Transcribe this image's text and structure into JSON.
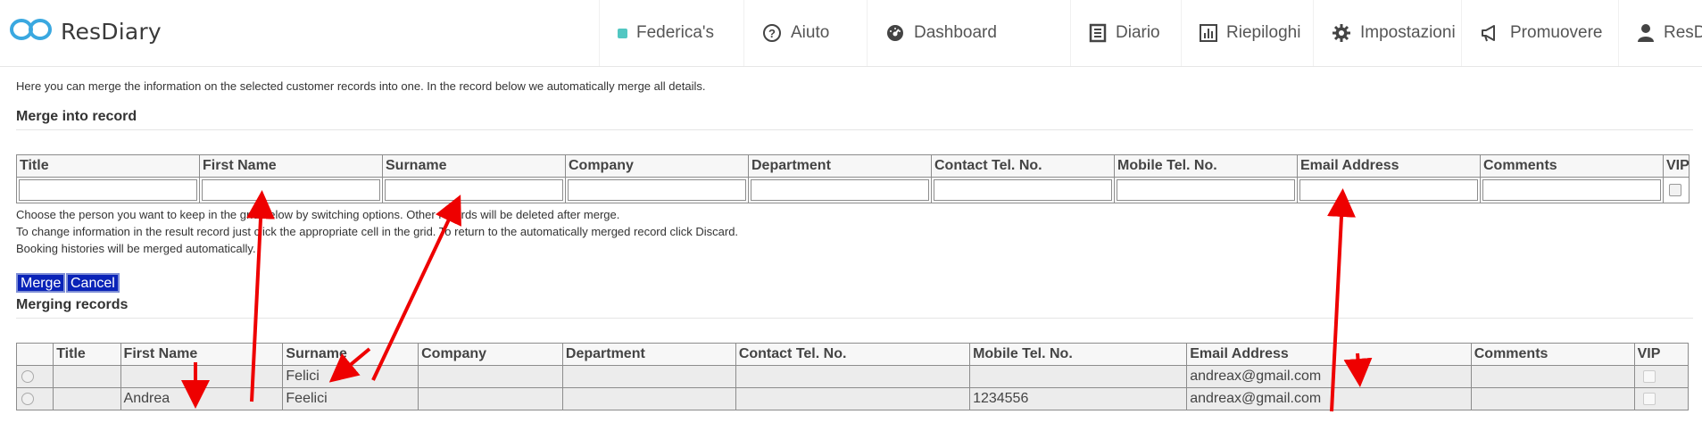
{
  "nav": {
    "brand": "ResDiary",
    "items": [
      {
        "icon": "restaurant-dot-icon",
        "label": "Federica's"
      },
      {
        "icon": "help-circle-icon",
        "label": "Aiuto"
      },
      {
        "icon": "dashboard-gauge-icon",
        "label": "Dashboard"
      },
      {
        "icon": "diary-book-icon",
        "label": "Diario"
      },
      {
        "icon": "bar-chart-icon",
        "label": "Riepiloghi"
      },
      {
        "icon": "gear-icon",
        "label": "Impostazioni"
      },
      {
        "icon": "megaphone-icon",
        "label": "Promuovere"
      },
      {
        "icon": "user-icon",
        "label": "ResDiary Tea..."
      }
    ]
  },
  "intro_text": "Here you can merge the information on the selected customer records into one. In the record below we automatically merge all details.",
  "merge_into": {
    "title": "Merge into record",
    "columns": [
      "Title",
      "First Name",
      "Surname",
      "Company",
      "Department",
      "Contact Tel. No.",
      "Mobile Tel. No.",
      "Email Address",
      "Comments",
      "VIP"
    ]
  },
  "help": {
    "line1": "Choose the person you want to keep in the grid below by switching options. Other records will be deleted after merge.",
    "line2": "To change information in the result record just click the appropriate cell in the grid. To return to the automatically merged record click Discard.",
    "line3": "Booking histories will be merged automatically."
  },
  "buttons": {
    "merge": "Merge",
    "cancel": "Cancel"
  },
  "merging": {
    "title": "Merging records",
    "columns": [
      "",
      "Title",
      "First Name",
      "Surname",
      "Company",
      "Department",
      "Contact Tel. No.",
      "Mobile Tel. No.",
      "Email Address",
      "Comments",
      "VIP"
    ],
    "rows": [
      {
        "title": "",
        "first_name": "",
        "surname": "Felici",
        "company": "",
        "department": "",
        "contact_tel": "",
        "mobile_tel": "",
        "email": "andreax@gmail.com",
        "comments": ""
      },
      {
        "title": "",
        "first_name": "Andrea",
        "surname": "Feelici",
        "company": "",
        "department": "",
        "contact_tel": "",
        "mobile_tel": "1234556",
        "email": "andreax@gmail.com",
        "comments": ""
      }
    ]
  },
  "colors": {
    "brand": "#3aa8e0",
    "button": "#0a23b8",
    "annotation_arrow": "#ee0000"
  }
}
